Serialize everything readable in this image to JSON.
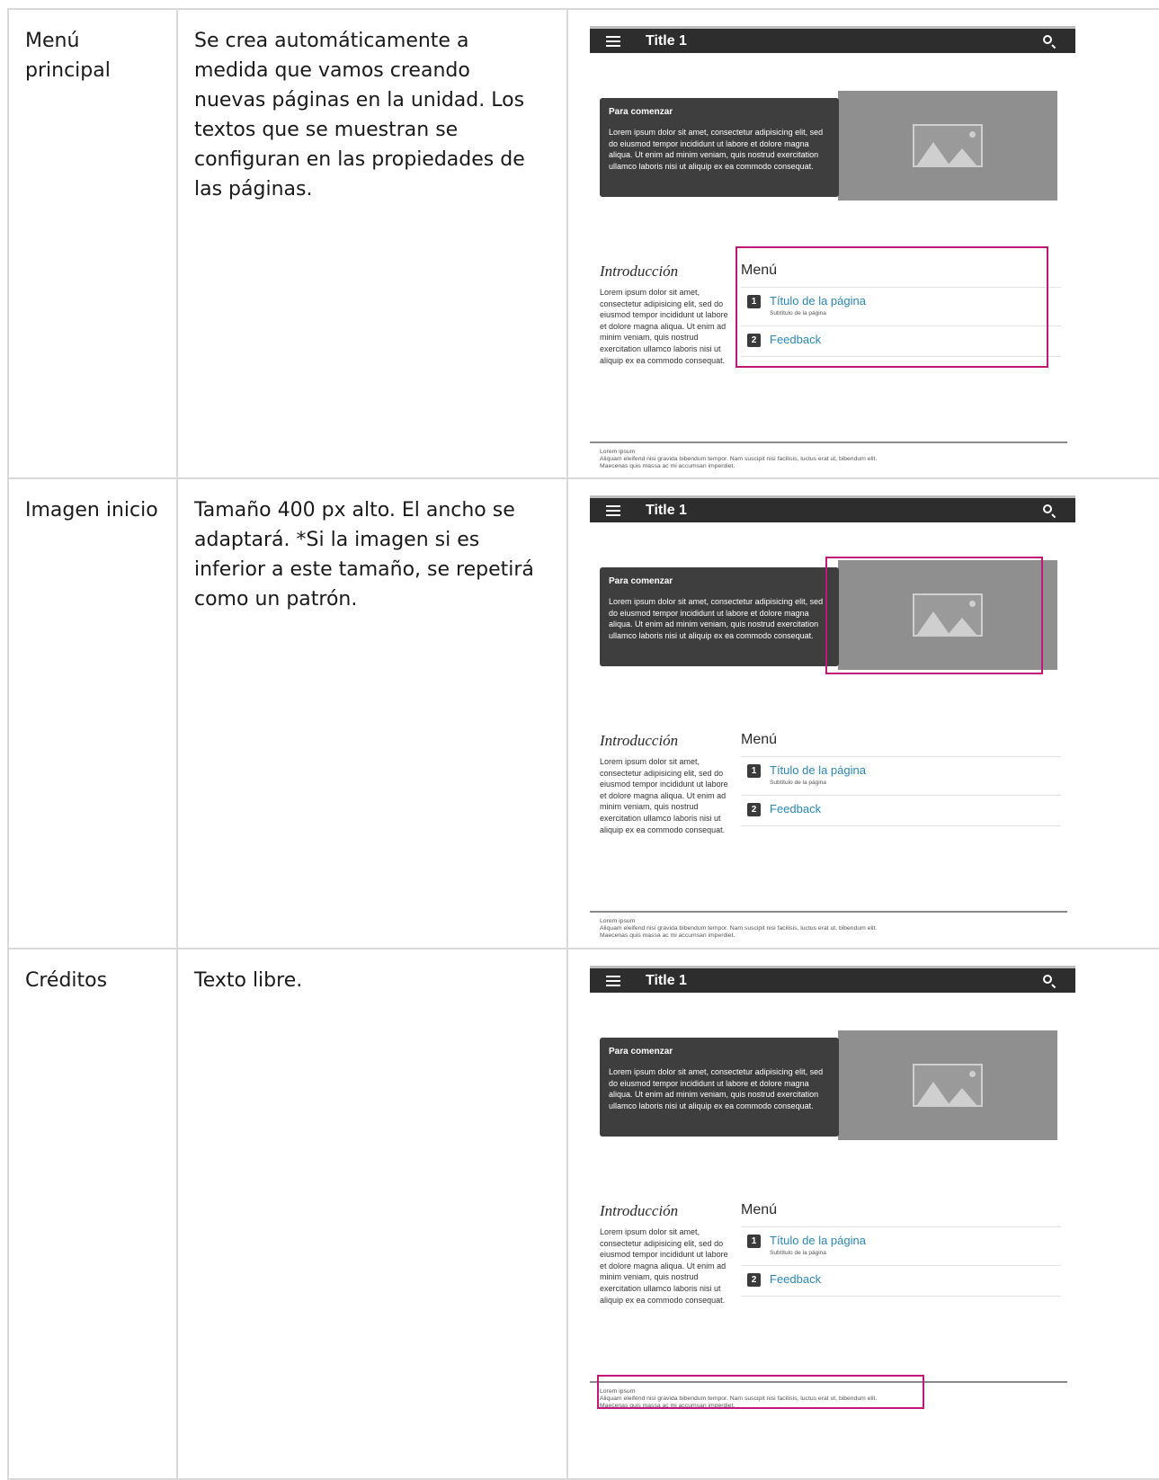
{
  "mockup": {
    "bar_title": "Title 1",
    "hero_heading": "Para comenzar",
    "hero_text": "Lorem ipsum dolor sit amet, consectetur adipisicing elit, sed do eiusmod tempor incididunt ut labore et dolore magna aliqua. Ut enim ad minim veniam, quis nostrud exercitation ullamco laboris nisi ut aliquip ex ea commodo consequat.",
    "intro_title": "Introducción",
    "intro_text": "Lorem ipsum dolor sit amet, consectetur adipisicing elit, sed do eiusmod tempor incididunt ut labore et dolore magna aliqua. Ut enim ad minim veniam, quis nostrud exercitation ullamco laboris nisi ut aliquip ex ea commodo consequat.",
    "menu_title": "Menú",
    "menu_items": [
      {
        "num": "1",
        "label": "Título de la página",
        "subtitle": "Subtítulo de la página"
      },
      {
        "num": "2",
        "label": "Feedback",
        "subtitle": ""
      }
    ],
    "footer_lines": [
      "Lorem ipsum",
      "Aliquam eleifend nisi gravida bibendum tempor. Nam suscipit nisi facilisis, luctus erat ut, bibendum elit.",
      "Maecenas quis massa ac mi accumsan imperdiet."
    ]
  },
  "rows": [
    {
      "name": "Menú principal",
      "description": "Se crea automáticamente a medida que vamos creando nuevas páginas en la unidad. Los textos que se muestran se configuran en las propiedades de las páginas.",
      "highlight": "menu"
    },
    {
      "name": "Imagen inicio",
      "description": "Tamaño 400 px alto. El ancho se adaptará. *Si la imagen si es inferior a este tamaño, se repetirá como un patrón.",
      "highlight": "image"
    },
    {
      "name": "Créditos",
      "description": "Texto libre.",
      "highlight": "footer"
    }
  ],
  "colors": {
    "highlight": "#c4177a",
    "link": "#2a86b6",
    "topbar": "#2d2d2d"
  }
}
